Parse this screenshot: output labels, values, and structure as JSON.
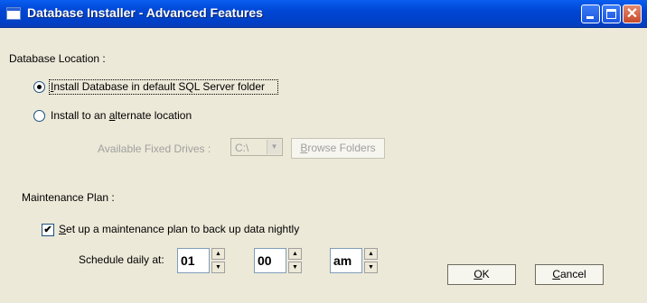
{
  "window": {
    "title": "Database Installer - Advanced Features"
  },
  "db_location": {
    "heading": "Database Location :",
    "option_default": {
      "pre": "",
      "key": "I",
      "post": "nstall Database in default SQL Server folder",
      "selected": true
    },
    "option_alternate": {
      "pre": "Install to an ",
      "key": "a",
      "post": "lternate location",
      "selected": false
    },
    "drives_label": "Available Fixed Drives :",
    "drive_value": "C:\\",
    "browse": {
      "key": "B",
      "post": "rowse Folders"
    }
  },
  "maintenance": {
    "heading": "Maintenance Plan :",
    "checkbox": {
      "key": "S",
      "post": "et up a maintenance plan to back up data nightly",
      "checked": true,
      "mark": "✔"
    },
    "schedule_label": "Schedule daily at:",
    "hour": "01",
    "minute": "00",
    "ampm": "am"
  },
  "buttons": {
    "ok": {
      "key": "O",
      "post": "K"
    },
    "cancel": {
      "key": "C",
      "post": "ancel"
    }
  }
}
